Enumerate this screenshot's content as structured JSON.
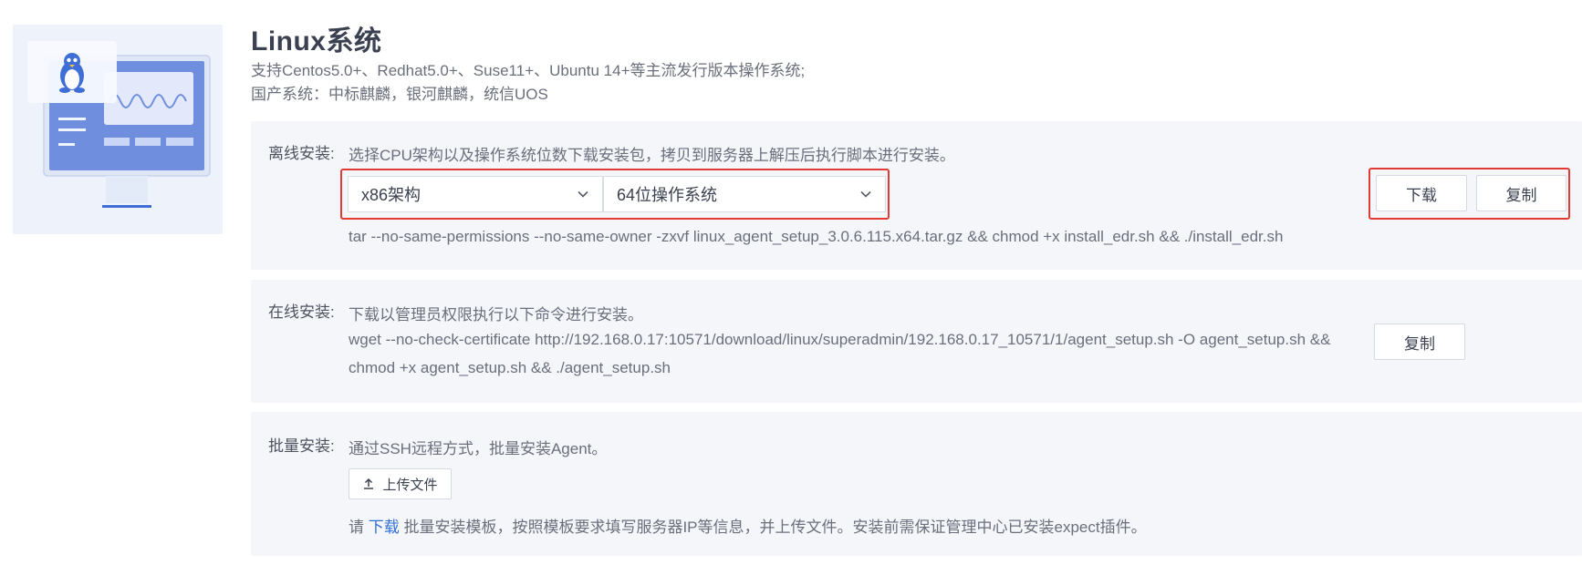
{
  "header": {
    "title": "Linux系统",
    "desc_line1": "支持Centos5.0+、Redhat5.0+、Suse11+、Ubuntu 14+等主流发行版本操作系统;",
    "desc_line2": "国产系统：中标麒麟，银河麒麟，统信UOS"
  },
  "offline": {
    "label": "离线安装:",
    "instruction": "选择CPU架构以及操作系统位数下载安装包，拷贝到服务器上解压后执行脚本进行安装。",
    "arch_select": "x86架构",
    "os_select": "64位操作系统",
    "download_label": "下载",
    "copy_label": "复制",
    "command": "tar --no-same-permissions --no-same-owner -zxvf linux_agent_setup_3.0.6.115.x64.tar.gz && chmod +x install_edr.sh && ./install_edr.sh"
  },
  "online": {
    "label": "在线安装:",
    "instruction": "下载以管理员权限执行以下命令进行安装。",
    "command_line1": "wget --no-check-certificate http://192.168.0.17:10571/download/linux/superadmin/192.168.0.17_10571/1/agent_setup.sh -O agent_setup.sh &&",
    "command_line2": "chmod +x agent_setup.sh && ./agent_setup.sh",
    "copy_label": "复制"
  },
  "batch": {
    "label": "批量安装:",
    "instruction": "通过SSH远程方式，批量安装Agent。",
    "upload_label": "上传文件",
    "note_prefix": "请 ",
    "note_link": "下载",
    "note_suffix": " 批量安装模板，按照模板要求填写服务器IP等信息，并上传文件。安装前需保证管理中心已安装expect插件。"
  },
  "icons": [
    "linux-tux-icon",
    "chevron-down-icon",
    "upload-icon"
  ],
  "colors": {
    "highlight": "#e23b35",
    "link": "#2f6fd6",
    "panel_bg": "#f4f6fa"
  }
}
